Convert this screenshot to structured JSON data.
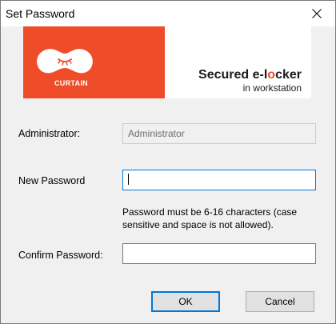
{
  "window": {
    "title": "Set Password",
    "close_icon": "close-icon"
  },
  "banner": {
    "logo_text": "CURTAIN",
    "tagline_part1": "Secured e-l",
    "tagline_accent": "o",
    "tagline_part2": "cker",
    "tagline_sub": "in workstation",
    "brand_color": "#ef4d2a"
  },
  "form": {
    "admin_label": "Administrator:",
    "admin_value": "Administrator",
    "new_password_label": "New Password",
    "new_password_value": "",
    "hint": "Password must be 6-16 characters (case sensitive and space is not allowed).",
    "confirm_password_label": "Confirm Password:",
    "confirm_password_value": ""
  },
  "buttons": {
    "ok": "OK",
    "cancel": "Cancel"
  },
  "colors": {
    "focus_border": "#0078d7",
    "dialog_bg": "#f0f0f0"
  }
}
